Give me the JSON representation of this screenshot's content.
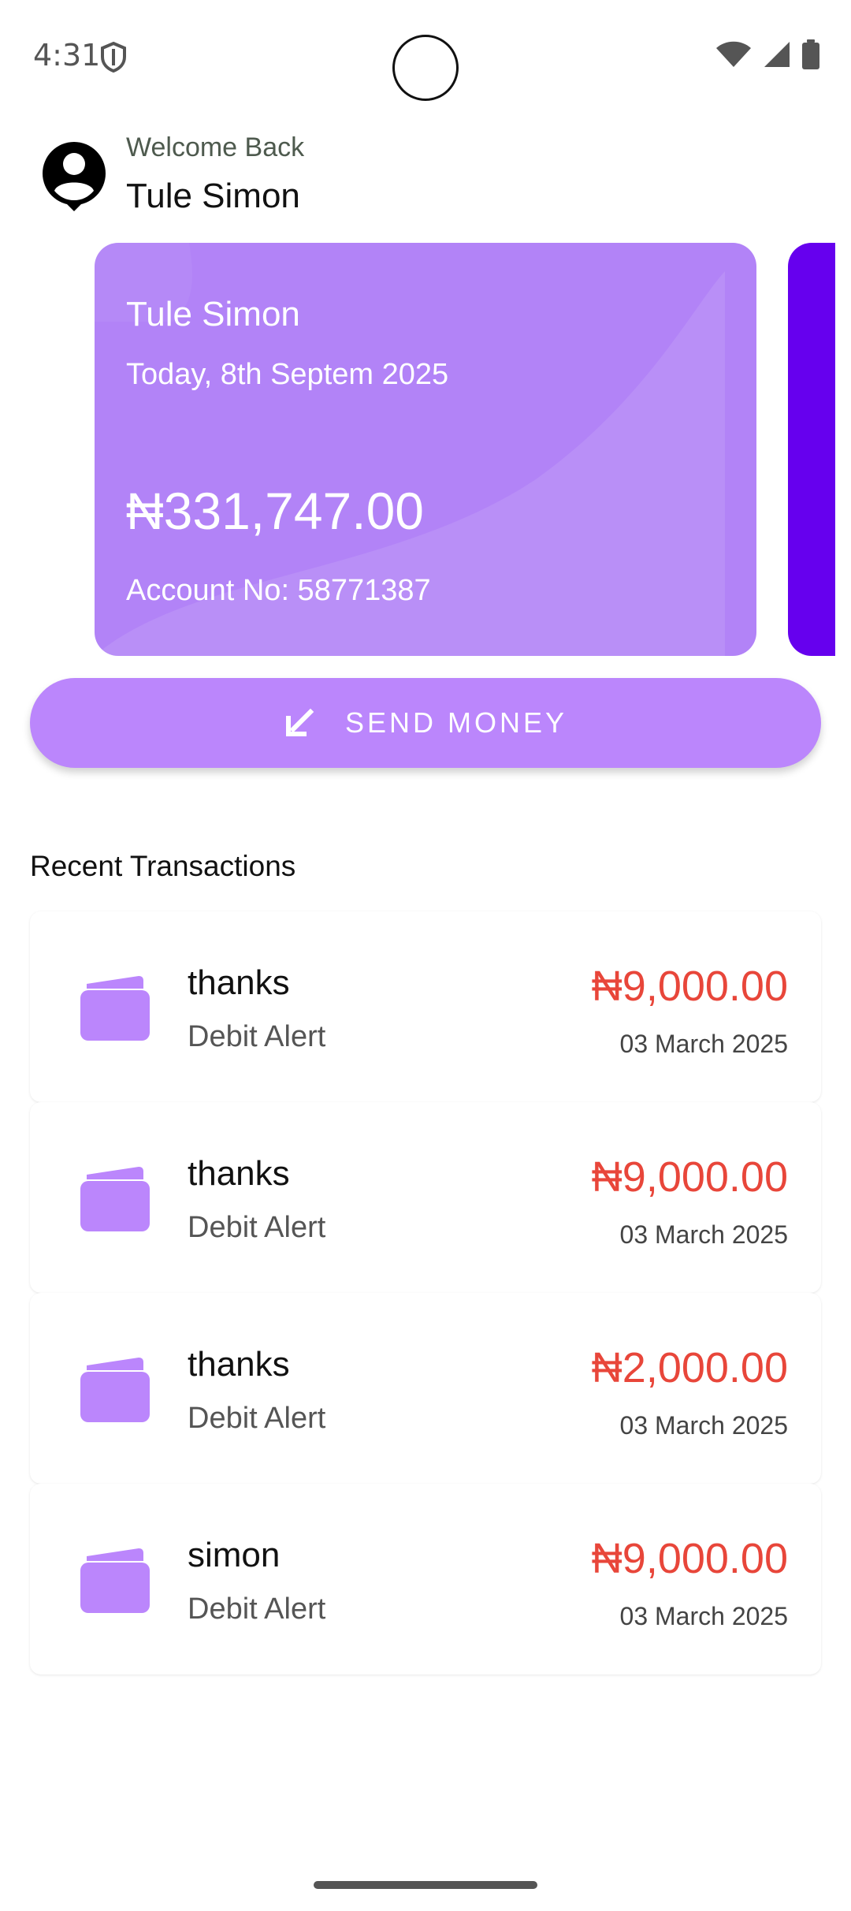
{
  "status_bar": {
    "time": "4:31",
    "icons": [
      "shield-icon",
      "wifi-icon",
      "signal-icon",
      "battery-icon"
    ]
  },
  "header": {
    "welcome": "Welcome Back",
    "name": "Tule Simon",
    "avatar_icon": "account-circle-icon"
  },
  "account_card": {
    "name": "Tule Simon",
    "date": "Today, 8th Septem 2025",
    "balance": "₦331,747.00",
    "account": "Account No: 58771387",
    "color": "#b283f7"
  },
  "next_card": {
    "color": "#6600ee"
  },
  "send_button": {
    "label": "SEND MONEY",
    "icon": "arrow-down-left-icon",
    "color": "#bb86fc"
  },
  "transactions": {
    "title": "Recent Transactions",
    "amount_color": "#e8463a",
    "items": [
      {
        "title": "thanks",
        "type": "Debit Alert",
        "amount": "₦9,000.00",
        "date": "03 March 2025",
        "icon": "wallet-icon"
      },
      {
        "title": "thanks",
        "type": "Debit Alert",
        "amount": "₦9,000.00",
        "date": "03 March 2025",
        "icon": "wallet-icon"
      },
      {
        "title": "thanks",
        "type": "Debit Alert",
        "amount": "₦2,000.00",
        "date": "03 March 2025",
        "icon": "wallet-icon"
      },
      {
        "title": "simon",
        "type": "Debit Alert",
        "amount": "₦9,000.00",
        "date": "03 March 2025",
        "icon": "wallet-icon"
      }
    ]
  }
}
